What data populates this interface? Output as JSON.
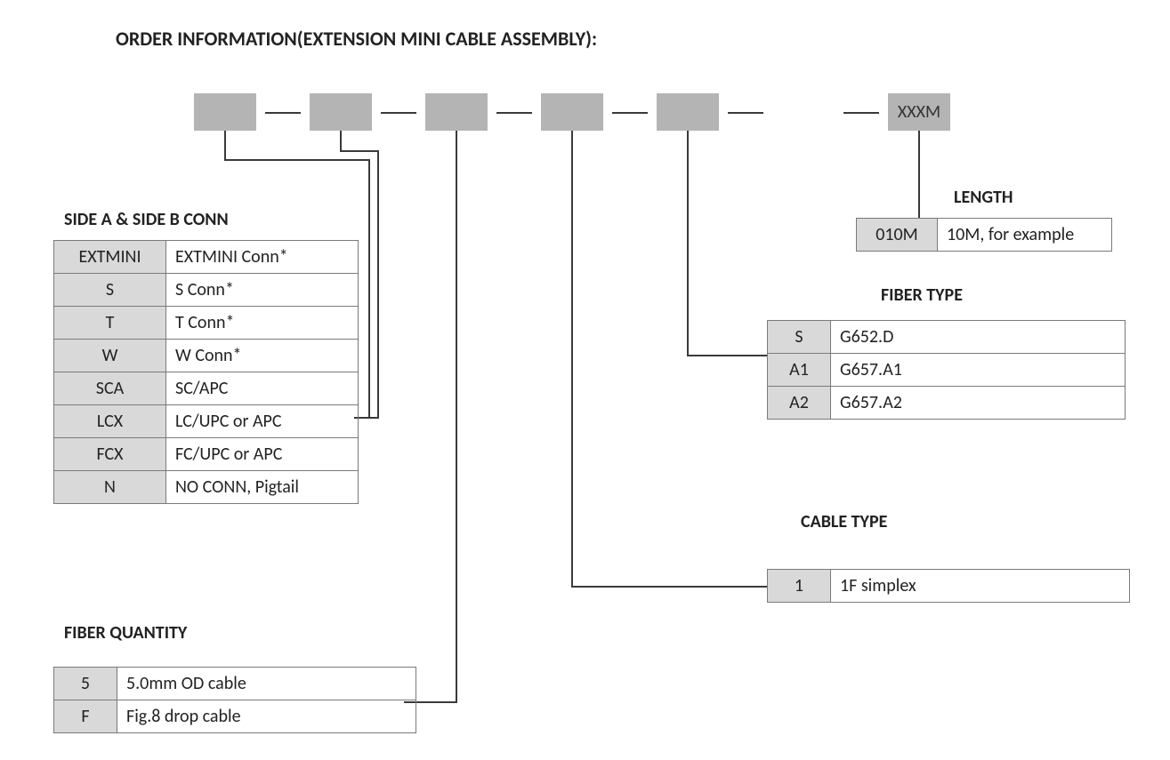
{
  "title": "ORDER INFORMATION(EXTENSION MINI CABLE ASSEMBLY):",
  "part_boxes": {
    "p1": "",
    "p2": "",
    "p3": "",
    "p4": "",
    "p5": "",
    "p6": "XXXM"
  },
  "sections": {
    "sideab": {
      "title": "SIDE A & SIDE B CONN",
      "rows": [
        {
          "code": "EXTMINI",
          "desc": "EXTMINI Conn*"
        },
        {
          "code": "S",
          "desc": "S Conn*"
        },
        {
          "code": "T",
          "desc": "T Conn*"
        },
        {
          "code": "W",
          "desc": "W Conn*"
        },
        {
          "code": "SCA",
          "desc": "SC/APC"
        },
        {
          "code": "LCX",
          "desc": "LC/UPC or APC"
        },
        {
          "code": "FCX",
          "desc": "FC/UPC or APC"
        },
        {
          "code": "N",
          "desc": "NO CONN, Pigtail"
        }
      ]
    },
    "fiberqty": {
      "title": "FIBER QUANTITY",
      "rows": [
        {
          "code": "5",
          "desc": "5.0mm OD cable"
        },
        {
          "code": "F",
          "desc": "Fig.8 drop cable"
        }
      ]
    },
    "length": {
      "title": "LENGTH",
      "rows": [
        {
          "code": "010M",
          "desc": "10M, for example"
        }
      ]
    },
    "fibertype": {
      "title": "FIBER TYPE",
      "rows": [
        {
          "code": "S",
          "desc": "G652.D"
        },
        {
          "code": "A1",
          "desc": "G657.A1"
        },
        {
          "code": "A2",
          "desc": "G657.A2"
        }
      ]
    },
    "cabletype": {
      "title": "CABLE TYPE",
      "rows": [
        {
          "code": "1",
          "desc": "1F simplex"
        }
      ]
    }
  }
}
